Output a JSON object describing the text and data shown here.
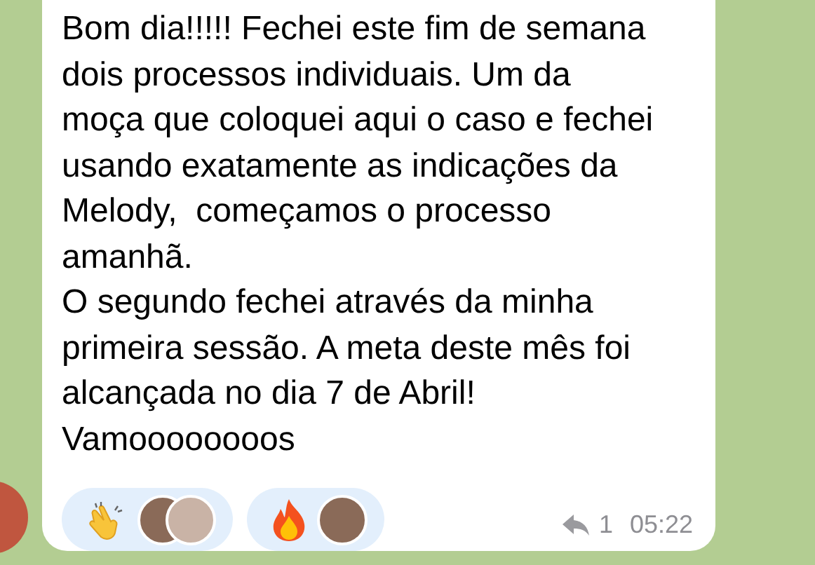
{
  "message": {
    "lines": [
      "Bom dia!!!!! Fechei este fim de semana",
      "dois processos individuais. Um da",
      "moça que coloquei aqui o caso e fechei",
      "usando exatamente as indicações da",
      "Melody,  começamos o processo",
      "amanhã.",
      "O segundo fechei através da minha",
      "primeira sessão. A meta deste mês foi",
      "alcançada no dia 7 de Abril!",
      "Vamoooooooos"
    ],
    "reactions": [
      {
        "kind": "clap",
        "avatars": [
          {
            "kind": "photo"
          },
          {
            "kind": "photo"
          }
        ]
      },
      {
        "kind": "fire",
        "avatars": [
          {
            "kind": "photo"
          }
        ]
      }
    ],
    "replies": "1",
    "time": "05:22"
  }
}
